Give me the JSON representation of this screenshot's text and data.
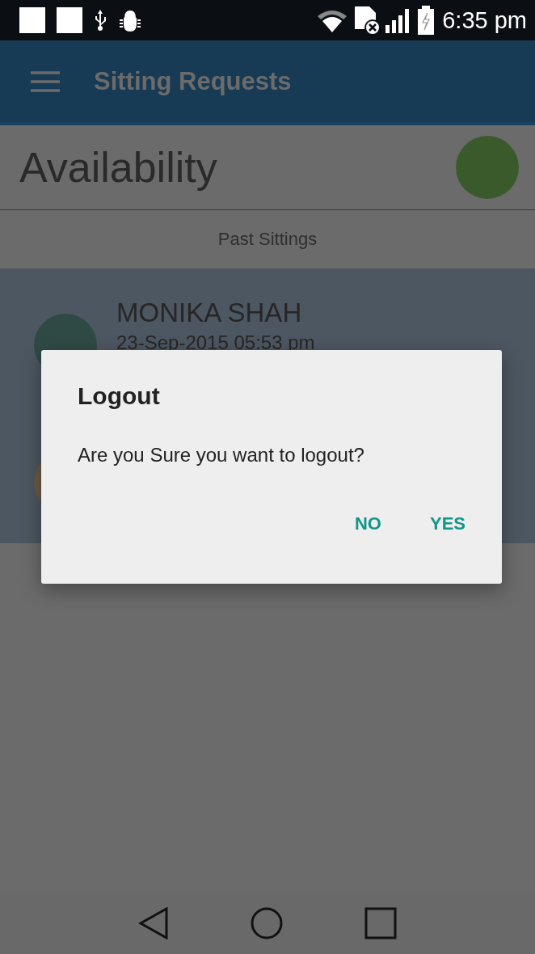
{
  "status_bar": {
    "time": "6:35 pm"
  },
  "app_bar": {
    "title": "Sitting Requests"
  },
  "header": {
    "title": "Availability"
  },
  "tabs": [
    {
      "label": "Past Sittings"
    }
  ],
  "sittings": [
    {
      "name": "MONIKA SHAH",
      "date": "23-Sep-2015 05:53 pm",
      "color": "#2f4a44"
    },
    {
      "color": "#6a5a45"
    }
  ],
  "dialog": {
    "title": "Logout",
    "message": "Are you Sure you want to logout?",
    "buttons": [
      "NO",
      "YES"
    ]
  }
}
